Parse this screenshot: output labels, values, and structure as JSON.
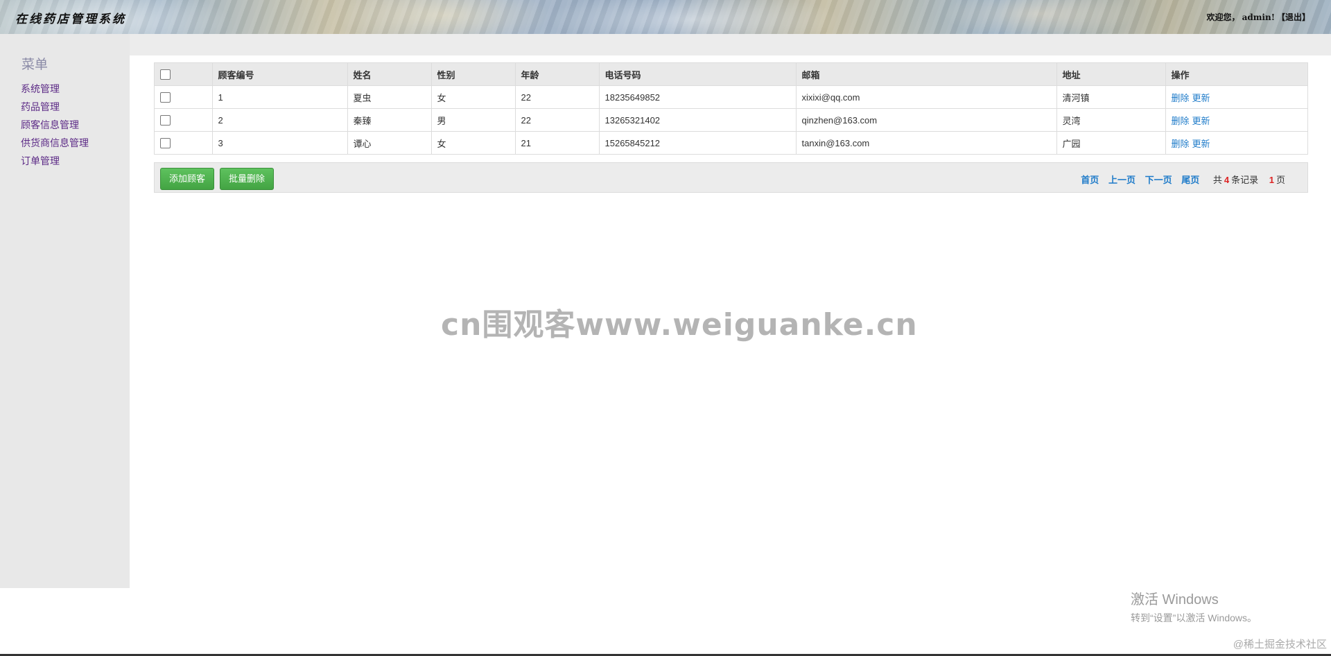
{
  "header": {
    "app_title": "在线药店管理系统",
    "welcome": "欢迎您，",
    "username": "admin!",
    "logout_label": "【退出】"
  },
  "sidebar": {
    "title": "菜单",
    "items": [
      {
        "label": "系统管理"
      },
      {
        "label": "药品管理"
      },
      {
        "label": "顾客信息管理"
      },
      {
        "label": "供货商信息管理"
      },
      {
        "label": "订单管理"
      }
    ]
  },
  "table": {
    "columns": [
      "顾客编号",
      "姓名",
      "性别",
      "年龄",
      "电话号码",
      "邮箱",
      "地址",
      "操作"
    ],
    "rows": [
      {
        "id": "1",
        "name": "夏虫",
        "gender": "女",
        "age": "22",
        "phone": "18235649852",
        "email": "xixixi@qq.com",
        "address": "清河镇"
      },
      {
        "id": "2",
        "name": "秦臻",
        "gender": "男",
        "age": "22",
        "phone": "13265321402",
        "email": "qinzhen@163.com",
        "address": "灵湾"
      },
      {
        "id": "3",
        "name": "谭心",
        "gender": "女",
        "age": "21",
        "phone": "15265845212",
        "email": "tanxin@163.com",
        "address": "广园"
      }
    ],
    "action_delete": "删除",
    "action_update": "更新"
  },
  "toolbar": {
    "add_label": "添加顾客",
    "batch_delete_label": "批量删除"
  },
  "pager": {
    "first": "首页",
    "prev": "上一页",
    "next": "下一页",
    "last": "尾页",
    "total_prefix": "共",
    "total_records": "4",
    "records_suffix": "条记录",
    "total_pages": "1",
    "pages_suffix": "页"
  },
  "overlay": {
    "site_watermark": "cn围观客www.weiguanke.cn",
    "activate_title": "激活 Windows",
    "activate_sub": "转到“设置”以激活 Windows。",
    "juejin": "@稀土掘金技术社区"
  }
}
